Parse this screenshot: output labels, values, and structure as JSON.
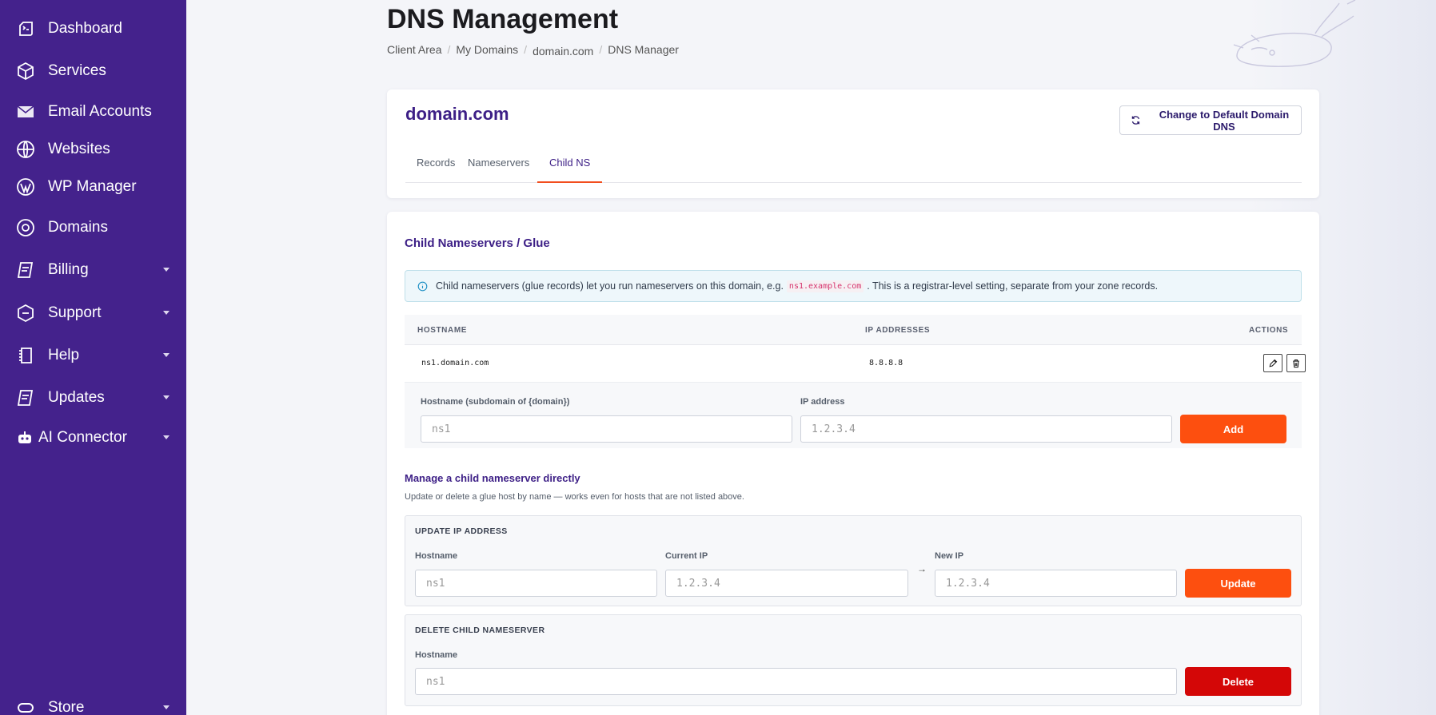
{
  "sidebar": {
    "items": [
      {
        "label": "Dashboard",
        "icon": "dashboard-icon"
      },
      {
        "label": "Services",
        "icon": "cube-icon"
      },
      {
        "label": "Email Accounts",
        "icon": "envelope-icon"
      },
      {
        "label": "Websites",
        "icon": "globe-icon"
      },
      {
        "label": "WP Manager",
        "icon": "wordpress-icon"
      },
      {
        "label": "Domains",
        "icon": "domain-icon"
      },
      {
        "label": "Billing",
        "icon": "billing-icon"
      },
      {
        "label": "Support",
        "icon": "support-icon"
      },
      {
        "label": "Help",
        "icon": "help-icon"
      },
      {
        "label": "Updates",
        "icon": "updates-icon"
      },
      {
        "label": "AI Connector",
        "icon": "robot-icon"
      },
      {
        "label": "Store",
        "icon": "store-icon"
      }
    ]
  },
  "header": {
    "title": "DNS Management",
    "breadcrumb": [
      "Client Area",
      "My Domains",
      "domain.com",
      "DNS Manager"
    ]
  },
  "domain_card": {
    "domain": "domain.com",
    "reset_button": "Change to Default Domain DNS",
    "tabs": [
      "Records",
      "Nameservers",
      "Child NS"
    ],
    "active_tab": "Child NS"
  },
  "child_ns": {
    "title": "Child Nameservers / Glue",
    "info_before": "Child nameservers (glue records) let you run nameservers on this domain, e.g.",
    "info_code": "ns1.example.com",
    "info_after": ". This is a registrar-level setting, separate from your zone records.",
    "table": {
      "headers": [
        "HOSTNAME",
        "IP ADDRESSES",
        "ACTIONS"
      ],
      "rows": [
        {
          "hostname": "ns1.domain.com",
          "ips": "8.8.8.8"
        }
      ]
    },
    "add_form": {
      "hostname_label": "Hostname (subdomain of {domain})",
      "hostname_placeholder": "ns1",
      "ip_label": "IP address",
      "ip_placeholder": "1.2.3.4",
      "add_button": "Add"
    },
    "manage": {
      "title": "Manage a child nameserver directly",
      "description": "Update or delete a glue host by name — works even for hosts that are not listed above.",
      "update": {
        "title": "UPDATE IP ADDRESS",
        "hostname_label": "Hostname",
        "hostname_placeholder": "ns1",
        "current_ip_label": "Current IP",
        "current_ip_placeholder": "1.2.3.4",
        "arrow": "→",
        "new_ip_label": "New IP",
        "new_ip_placeholder": "1.2.3.4",
        "button": "Update"
      },
      "delete": {
        "title": "DELETE CHILD NAMESERVER",
        "hostname_label": "Hostname",
        "hostname_placeholder": "ns1",
        "button": "Delete"
      }
    }
  },
  "colors": {
    "sidebar_bg": "#44228c",
    "accent": "#3d1f86",
    "primary_button": "#fd4f0f",
    "danger_button": "#d40707",
    "active_tab_underline": "#f24e1e"
  }
}
